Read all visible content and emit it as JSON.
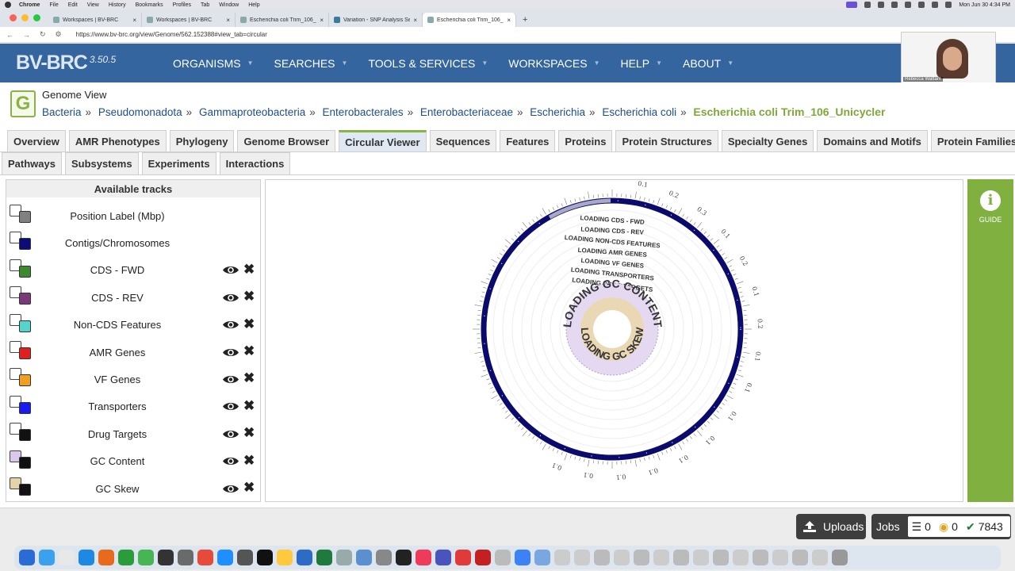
{
  "mac_menu": {
    "app": "Chrome",
    "items": [
      "File",
      "Edit",
      "View",
      "History",
      "Bookmarks",
      "Profiles",
      "Tab",
      "Window",
      "Help"
    ],
    "clock": "Mon Jun 30  4:34 PM"
  },
  "browser": {
    "tabs": [
      {
        "title": "Workspaces | BV-BRC"
      },
      {
        "title": "Workspaces | BV-BRC"
      },
      {
        "title": "Escherichia coli Trim_106_U..."
      },
      {
        "title": "Variation - SNP Analysis Serv..."
      },
      {
        "title": "Escherichia coli Trim_106_U..."
      }
    ],
    "new_tab": "+",
    "url": "https://www.bv-brc.org/view/Genome/562.152388#view_tab=circular"
  },
  "header": {
    "logo": "BV-BRC",
    "version": "3.50.5",
    "nav": [
      "ORGANISMS",
      "SEARCHES",
      "TOOLS & SERVICES",
      "WORKSPACES",
      "HELP",
      "ABOUT"
    ],
    "webcam_name": "Rebecca Wattam"
  },
  "page": {
    "icon_letter": "G",
    "title": "Genome View",
    "breadcrumbs": [
      "Bacteria",
      "Pseudomonadota",
      "Gammaproteobacteria",
      "Enterobacterales",
      "Enterobacteriaceae",
      "Escherichia",
      "Escherichia coli"
    ],
    "current": "Escherichia coli Trim_106_Unicycler",
    "tabs_row1": [
      "Overview",
      "AMR Phenotypes",
      "Phylogeny",
      "Genome Browser",
      "Circular Viewer",
      "Sequences",
      "Features",
      "Proteins",
      "Protein Structures",
      "Specialty Genes",
      "Domains and Motifs",
      "Protein Families"
    ],
    "tabs_row2": [
      "Pathways",
      "Subsystems",
      "Experiments",
      "Interactions"
    ],
    "active_tab": "Circular Viewer"
  },
  "tracks": {
    "header": "Available tracks",
    "items": [
      {
        "label": "Position Label (Mbp)",
        "color": "#808080",
        "controls": false
      },
      {
        "label": "Contigs/Chromosomes",
        "color": "#0b0b7a",
        "controls": false
      },
      {
        "label": "CDS - FWD",
        "color": "#3c8a2e",
        "controls": true
      },
      {
        "label": "CDS - REV",
        "color": "#7a3a7a",
        "controls": true
      },
      {
        "label": "Non-CDS Features",
        "color": "#55d4cc",
        "controls": true
      },
      {
        "label": "AMR Genes",
        "color": "#e02020",
        "controls": true
      },
      {
        "label": "VF Genes",
        "color": "#f0a020",
        "controls": true
      },
      {
        "label": "Transporters",
        "color": "#1a1aee",
        "controls": true
      },
      {
        "label": "Drug Targets",
        "color": "#111111",
        "controls": true
      },
      {
        "label": "GC Content",
        "color": "#111111",
        "back_color": "#d9c9ec",
        "controls": true
      },
      {
        "label": "GC Skew",
        "color": "#111111",
        "back_color": "#e6d2a8",
        "controls": true
      }
    ]
  },
  "viewer": {
    "loading_labels": [
      "LOADING CDS - FWD",
      "LOADING CDS - REV",
      "LOADING NON-CDS FEATURES",
      "LOADING AMR GENES",
      "LOADING VF GENES",
      "LOADING TRANSPORTERS",
      "LOADING DRUG TARGETS"
    ],
    "gc_content_label": "LOADING GC CONTENT",
    "gc_skew_label": "LOADING GC SKEW",
    "scale_labels": [
      "0.1",
      "0.2",
      "0.3",
      "0.1",
      "0.2",
      "0.1",
      "0.2",
      "0.1",
      "0.1",
      "0.1",
      "0.1",
      "0.1",
      "0.1",
      "0.1",
      "0.1",
      "0.1"
    ],
    "backbone_color": "#0b0b6e"
  },
  "guide": {
    "label": "GUIDE",
    "icon": "info-icon"
  },
  "bottom": {
    "uploads": "Uploads",
    "jobs": "Jobs",
    "queued": "0",
    "running": "0",
    "completed": "7843"
  }
}
